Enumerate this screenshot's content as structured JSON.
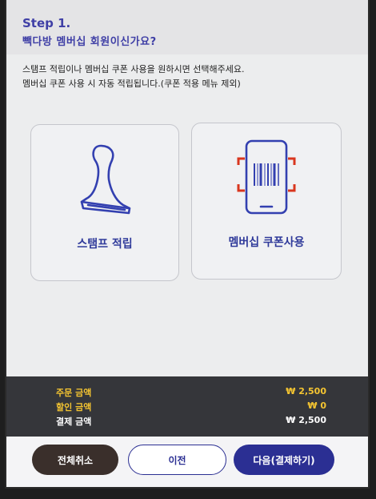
{
  "header": {
    "step": "Step 1.",
    "question": "빽다방 멤버십 회원이신가요?"
  },
  "description": {
    "line1": "스탬프 적립이나 멤버십 쿠폰 사용을 원하시면 선택해주세요.",
    "line2": "멤버십 쿠폰 사용 시 자동 적립됩니다.(쿠폰 적용 메뉴 제외)"
  },
  "options": {
    "stamp_label": "스탬프 적립",
    "coupon_label": "멤버십 쿠폰사용"
  },
  "summary": {
    "order_label": "주문 금액",
    "order_value": "₩ 2,500",
    "discount_label": "할인 금액",
    "discount_value": "₩ 0",
    "payment_label": "결제 금액",
    "payment_value": "₩ 2,500"
  },
  "buttons": {
    "cancel_all": "전체취소",
    "previous": "이전",
    "next": "다음(결제하기)"
  },
  "colors": {
    "accent": "#2b2f93",
    "highlight": "#f5c531",
    "scanner_red": "#d9361e"
  },
  "icons": {
    "stamp": "stamp-icon",
    "coupon": "phone-barcode-icon"
  }
}
